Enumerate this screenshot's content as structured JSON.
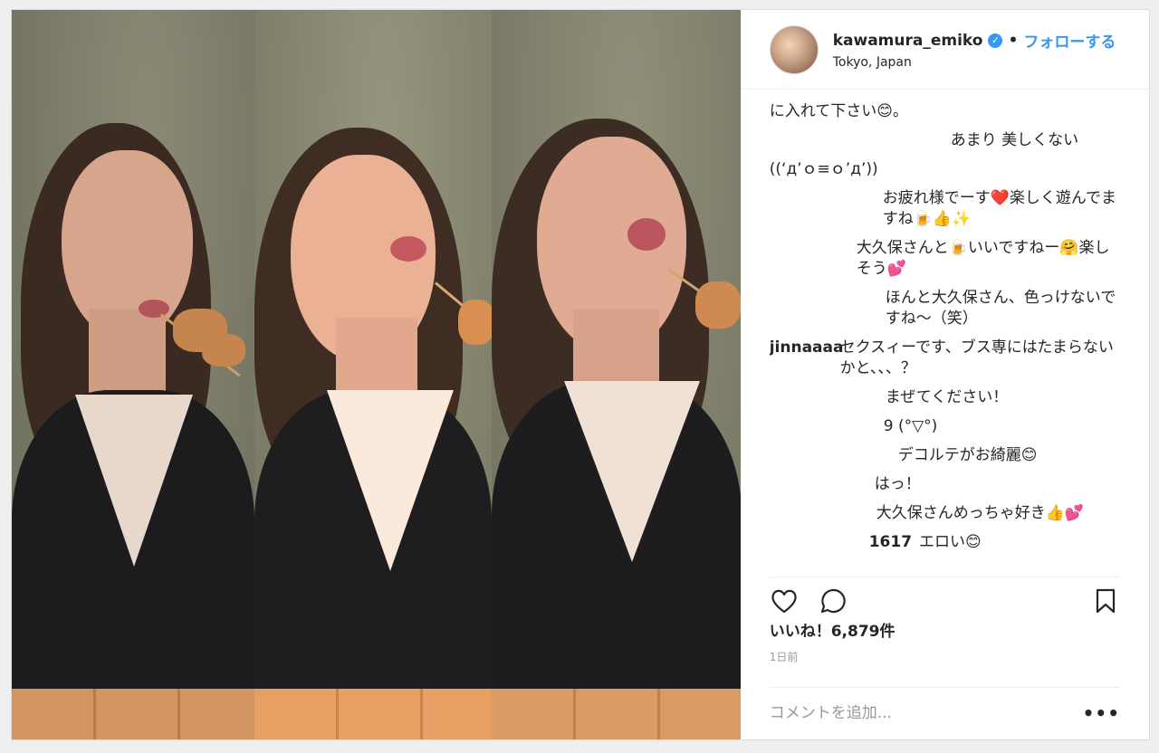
{
  "post": {
    "username": "kawamura_emiko",
    "separator": "•",
    "follow_label": "フォローする",
    "location": "Tokyo, Japan",
    "verified_mark": "✓"
  },
  "comments": [
    {
      "user": "",
      "text": "に入れて下さい😊。"
    },
    {
      "user": "",
      "text": "あまり 美しくない"
    },
    {
      "user": "",
      "text": "((‘д’ｏ≡ｏ’д’))"
    },
    {
      "user": "",
      "text": "お疲れ様でーす❤️楽しく遊んでますね🍺👍✨"
    },
    {
      "user": "",
      "text": "大久保さんと🍺いいですねー🤗楽しそう💕"
    },
    {
      "user": "",
      "text": "ほんと大久保さん、色っけないですね〜（笑）"
    },
    {
      "user": "jinnaaaa",
      "text": "セクスィーです、ブス専にはたまらないかと、、、？"
    },
    {
      "user": "",
      "text": "まぜてください！"
    },
    {
      "user": "",
      "text": "9 (°▽°)"
    },
    {
      "user": "",
      "text": "デコルテがお綺麗😊"
    },
    {
      "user": "",
      "text": "はっ！"
    },
    {
      "user": "",
      "text": "大久保さんめっちゃ好き👍💕"
    },
    {
      "user": "1617",
      "text": "エロい😊"
    }
  ],
  "likes_label": "いいね！6,879件",
  "time_label": "1日前",
  "add_comment_placeholder": "コメントを追加...",
  "more_label": "•••",
  "icons": {
    "like": "heart-icon",
    "comment": "comment-icon",
    "save": "bookmark-icon"
  }
}
